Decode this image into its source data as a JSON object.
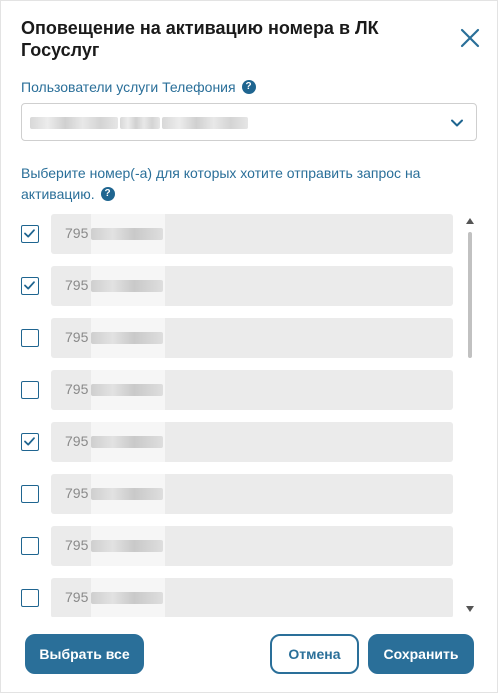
{
  "dialog": {
    "title": "Оповещение на активацию номера в ЛК Госуслуг",
    "close_icon": "close-icon"
  },
  "users": {
    "label": "Пользователи услуги Телефония",
    "help_glyph": "?",
    "selected_value": ""
  },
  "numbers_section": {
    "label": "Выберите номер(-а) для которых хотите отправить запрос на активацию.",
    "help_glyph": "?"
  },
  "numbers": [
    {
      "prefix": "795",
      "checked": true
    },
    {
      "prefix": "795",
      "checked": true
    },
    {
      "prefix": "795",
      "checked": false
    },
    {
      "prefix": "795",
      "checked": false
    },
    {
      "prefix": "795",
      "checked": true
    },
    {
      "prefix": "795",
      "checked": false
    },
    {
      "prefix": "795",
      "checked": false
    },
    {
      "prefix": "795",
      "checked": false
    }
  ],
  "footer": {
    "select_all_label": "Выбрать все",
    "cancel_label": "Отмена",
    "save_label": "Сохранить"
  },
  "colors": {
    "accent": "#2a6f99",
    "field_bg": "#ebebeb",
    "label_text": "#2a6f99"
  }
}
